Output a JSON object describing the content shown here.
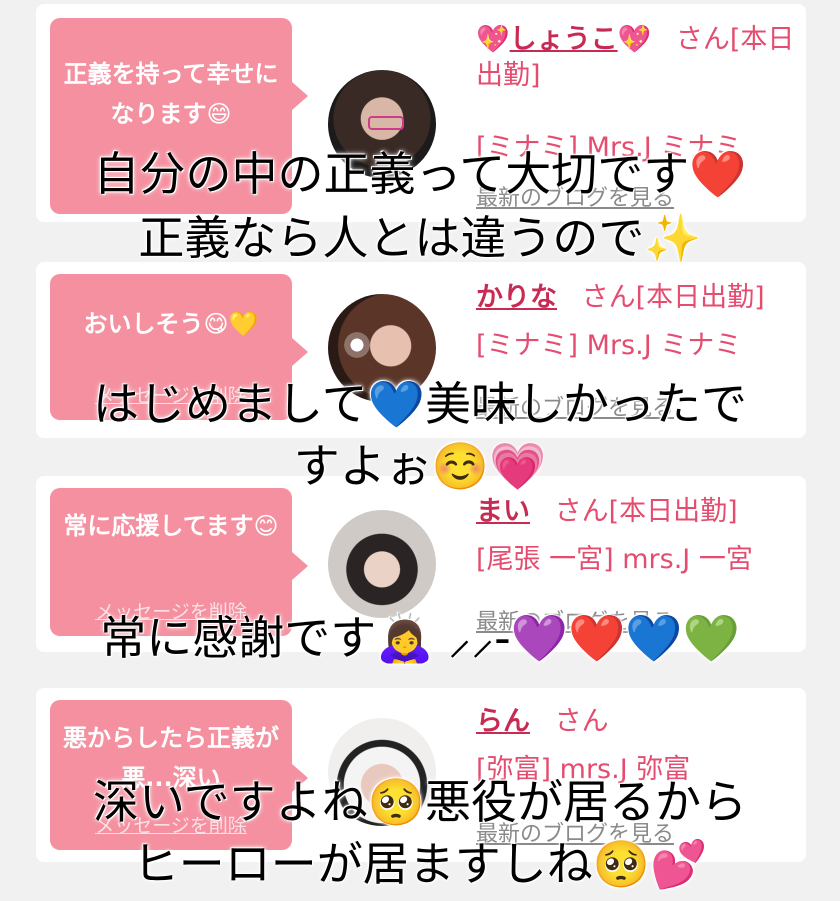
{
  "cards": [
    {
      "message": "正義を持って幸せになります😄",
      "delete_label": "",
      "name_prefix_icon": "💖",
      "name": "しょうこ",
      "name_suffix_icon": "💖",
      "status": "さん[本日出勤]",
      "shop": "[ミナミ] Mrs.J ミナミ",
      "blog_link": "最新のブログを見る"
    },
    {
      "message": "おいしそう😋💛",
      "delete_label": "メッセージを削除",
      "name": "かりな",
      "status": "さん[本日出勤]",
      "shop": "[ミナミ] Mrs.J ミナミ",
      "blog_link": "最新のブログを見る"
    },
    {
      "message": "常に応援してます😊",
      "delete_label": "メッセージを削除",
      "name": "まい",
      "status": "さん[本日出勤]",
      "shop": "[尾張 一宮] mrs.J 一宮",
      "blog_link": "最新のブログを見る"
    },
    {
      "message": "悪からしたら正義が悪...深い",
      "delete_label": "メッセージを削除",
      "name": "らん",
      "status": "さん",
      "shop": "[弥富] mrs.J 弥富",
      "blog_link": "最新のブログを見る"
    }
  ],
  "overlay": {
    "line1": "自分の中の正義って大切です❤️",
    "line2": "正義なら人とは違うので✨",
    "line3": "はじめまして💙美味しかったで",
    "line4": "すよぉ☺️💗",
    "line5": "常に感謝です🙇‍♀️ ⸝⸝-💜❤️💙💚",
    "line6": "深いですよね🥺悪役が居るから",
    "line7": "ヒーローが居ますしね🥺💕"
  },
  "colors": {
    "bubble": "#f4909f",
    "name": "#c72b53",
    "text_pink": "#e44d6f",
    "link_gray": "#8a8a8a"
  }
}
